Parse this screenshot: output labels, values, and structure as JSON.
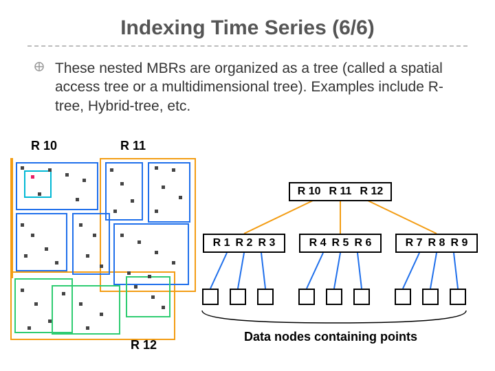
{
  "title": "Indexing Time Series (6/6)",
  "bullet": "These nested MBRs are organized as a tree (called a spatial access tree or a multidimensional tree). Examples include R-tree, Hybrid-tree, etc.",
  "labels": {
    "r10": "R 10",
    "r11": "R 11",
    "r12": "R 12"
  },
  "tree": {
    "root": [
      "R 10",
      "R 11",
      "R 12"
    ],
    "mid_left": [
      "R 1",
      "R 2",
      "R 3"
    ],
    "mid_center": [
      "R 4",
      "R 5",
      "R 6"
    ],
    "mid_right": [
      "R 7",
      "R 8",
      "R 9"
    ],
    "caption": "Data nodes containing points"
  },
  "colors": {
    "orange": "#F39C12",
    "blue": "#1F6FEB",
    "cyan": "#00B8D4",
    "green": "#2ECC71",
    "pink": "#E91E63"
  }
}
